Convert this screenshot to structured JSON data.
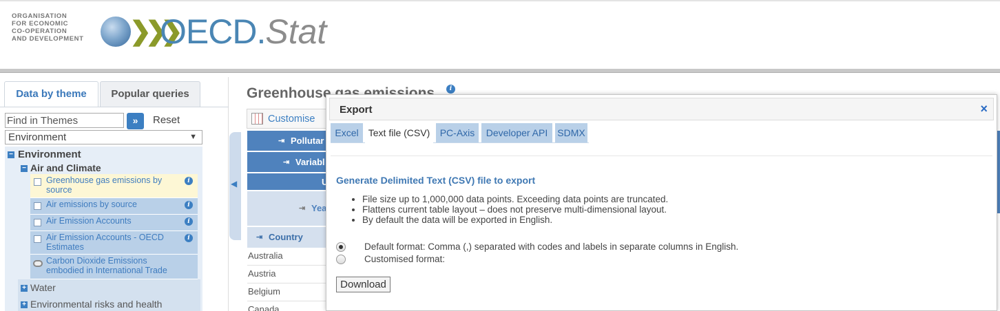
{
  "header": {
    "org_lines": [
      "ORGANISATION",
      "FOR ECONOMIC",
      "CO-OPERATION",
      "AND DEVELOPMENT"
    ],
    "brand_main": "OECD",
    "brand_dot": ".",
    "brand_stat": "Stat",
    "brand_colors": {
      "blue": "#4a86b4",
      "grey": "#8c8c8c",
      "chevrons": "#8b9a2a"
    }
  },
  "left_panel": {
    "tabs": [
      {
        "label": "Data by theme",
        "active": true
      },
      {
        "label": "Popular queries",
        "active": false
      }
    ],
    "search_placeholder": "Find in Themes",
    "go_icon": "»",
    "reset_label": "Reset",
    "theme_selected": "Environment",
    "tree": {
      "root": "Environment",
      "group": "Air and Climate",
      "datasets": [
        {
          "label": "Greenhouse gas emissions by source",
          "selected": true
        },
        {
          "label": "Air emissions by source",
          "selected": false
        },
        {
          "label": "Air Emission Accounts",
          "selected": false
        },
        {
          "label": "Air Emission Accounts - OECD Estimates",
          "selected": false
        },
        {
          "label": "Carbon Dioxide Emissions embodied in International Trade",
          "selected": false
        }
      ],
      "other_groups": [
        "Water",
        "Environmental risks and health"
      ]
    }
  },
  "main": {
    "title": "Greenhouse gas emissions",
    "customise_label": "Customise",
    "dimension_headers": [
      "Pollutar",
      "Variabl",
      "U",
      "Yea"
    ],
    "country_header": "Country",
    "countries": [
      "Australia",
      "Austria",
      "Belgium",
      "Canada"
    ]
  },
  "export_dialog": {
    "title": "Export",
    "close_icon": "×",
    "tabs": [
      {
        "label": "Excel",
        "active": false
      },
      {
        "label": "Text file (CSV)",
        "active": true
      },
      {
        "label": "PC-Axis",
        "active": false
      },
      {
        "label": "Developer API",
        "active": false
      },
      {
        "label": "SDMX",
        "active": false
      }
    ],
    "heading": "Generate Delimited Text (CSV) file to export",
    "bullets": [
      "File size up to 1,000,000 data points. Exceeding data points are truncated.",
      "Flattens current table layout – does not preserve multi-dimensional layout.",
      "By default the data will be exported in English."
    ],
    "options": [
      {
        "label": "Default format: Comma (,) separated with codes and labels in separate columns in English.",
        "checked": true
      },
      {
        "label": "Customised format:",
        "checked": false
      }
    ],
    "download_label": "Download"
  }
}
